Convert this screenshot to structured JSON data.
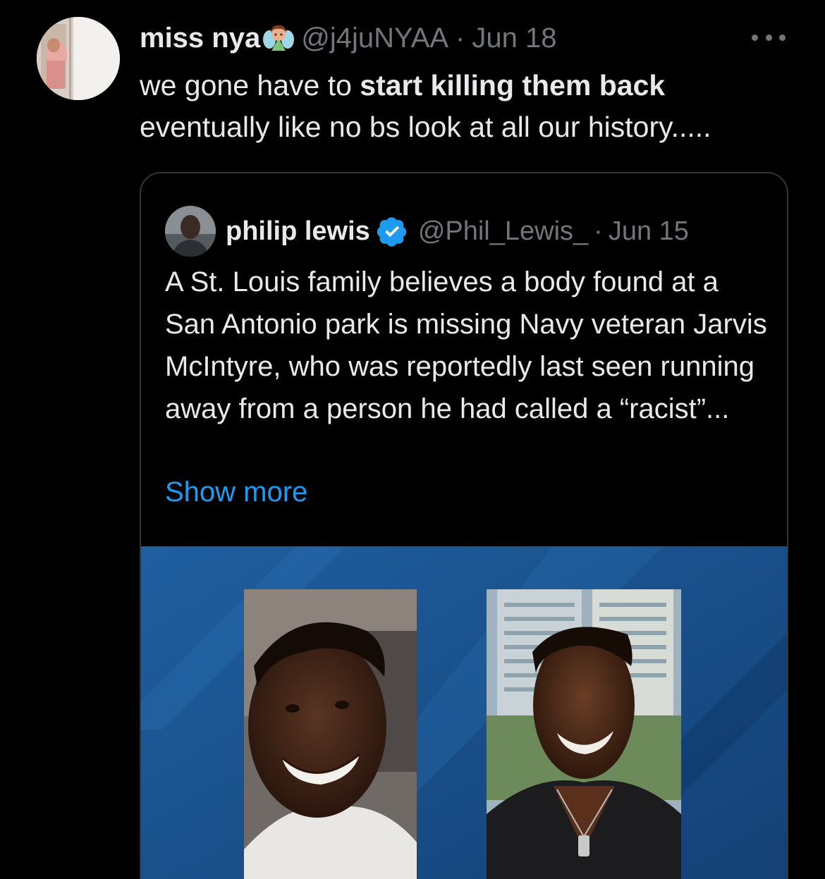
{
  "tweet": {
    "display_name": "miss nya",
    "handle": "@j4juNYAA",
    "separator": "·",
    "date": "Jun 18",
    "text_before": "we gone have to ",
    "text_bold": "start killing them back",
    "text_after": " eventually like no bs look at all our history.....",
    "name_emoji_icon": "fairy-emoji-icon",
    "more_icon": "more-options-icon"
  },
  "quoted_tweet": {
    "display_name": "philip lewis",
    "handle": "@Phil_Lewis_",
    "separator": "·",
    "date": "Jun 15",
    "text": "A St. Louis family believes a body found at a San Antonio park is missing Navy veteran Jarvis McIntyre, who was reportedly last seen running away from a person he had called a “racist”...",
    "show_more_label": "Show more",
    "verified_icon": "verified-badge-icon"
  },
  "colors": {
    "background": "#000000",
    "text_primary": "#e7e9ea",
    "text_secondary": "#71767b",
    "link": "#1d9bf0",
    "border": "#333639",
    "media_background": "#1a4f8a"
  }
}
